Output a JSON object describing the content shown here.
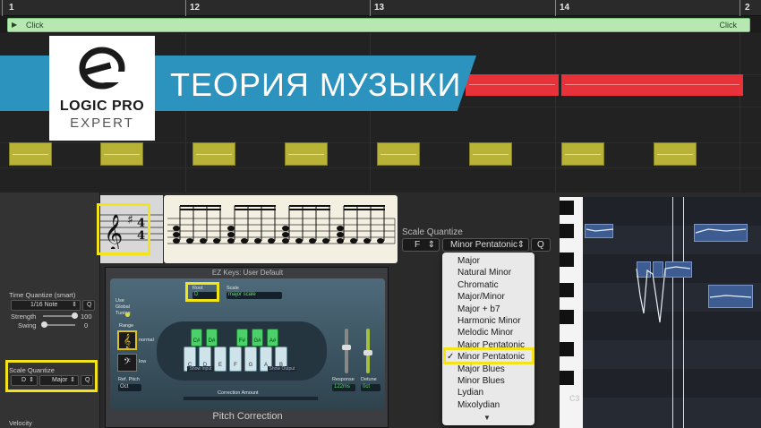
{
  "ruler": {
    "bars": [
      "1",
      "12",
      "13",
      "14",
      "2"
    ]
  },
  "region": {
    "left_label": "Click",
    "right_label": "Click"
  },
  "banner": {
    "title": "ТЕОРИЯ МУЗЫКИ"
  },
  "logo": {
    "line1": "LOGIC PRO",
    "line2": "EXPERT"
  },
  "inspector": {
    "time_quantize_label": "Time Quantize (smart)",
    "time_quantize_value": "1/16 Note",
    "q_button": "Q",
    "strength_label": "Strength",
    "strength_value": "100",
    "swing_label": "Swing",
    "swing_value": "0",
    "scale_quantize_label": "Scale Quantize",
    "scale_root": "D",
    "scale_type": "Major",
    "velocity_label": "Velocity"
  },
  "plugin": {
    "title": "EZ Keys: User Default",
    "footer": "Pitch Correction",
    "root_label": "Root",
    "root_value": "D",
    "scale_label": "Scale",
    "scale_value": "major scale",
    "use_global_tuning": "Use Global Tuning",
    "range_label": "Range",
    "range_normal": "normal",
    "range_low": "low",
    "ref_pitch_label": "Ref. Pitch",
    "ref_pitch_value": "Oct",
    "show_input": "Show Input",
    "show_output": "Show Output",
    "response_label": "Response",
    "response_value": "122ms",
    "detune_label": "Detune",
    "detune_value": "0ct",
    "correction_amount": "Correction Amount",
    "keys_white": [
      "C",
      "D",
      "E",
      "F",
      "G",
      "A",
      "B"
    ],
    "keys_green": [
      "C#",
      "D#",
      "F#",
      "G#",
      "A#"
    ]
  },
  "scale_panel": {
    "label": "Scale Quantize",
    "root": "F",
    "scale": "Minor Pentatonic",
    "q_button": "Q"
  },
  "scale_menu": {
    "items": [
      "Major",
      "Natural Minor",
      "Chromatic",
      "Major/Minor",
      "Major + b7",
      "Harmonic Minor",
      "Melodic Minor",
      "Major Pentatonic",
      "Minor Pentatonic",
      "Major Blues",
      "Minor Blues",
      "Lydian",
      "Mixolydian"
    ],
    "selected": "Minor Pentatonic",
    "more_arrow": "▼"
  },
  "piano_roll": {
    "c3_label": "C3"
  },
  "colors": {
    "banner": "#2b93be",
    "highlight": "#f2e31a",
    "red_region": "#e8323a",
    "note_yellow": "#b8b236"
  }
}
